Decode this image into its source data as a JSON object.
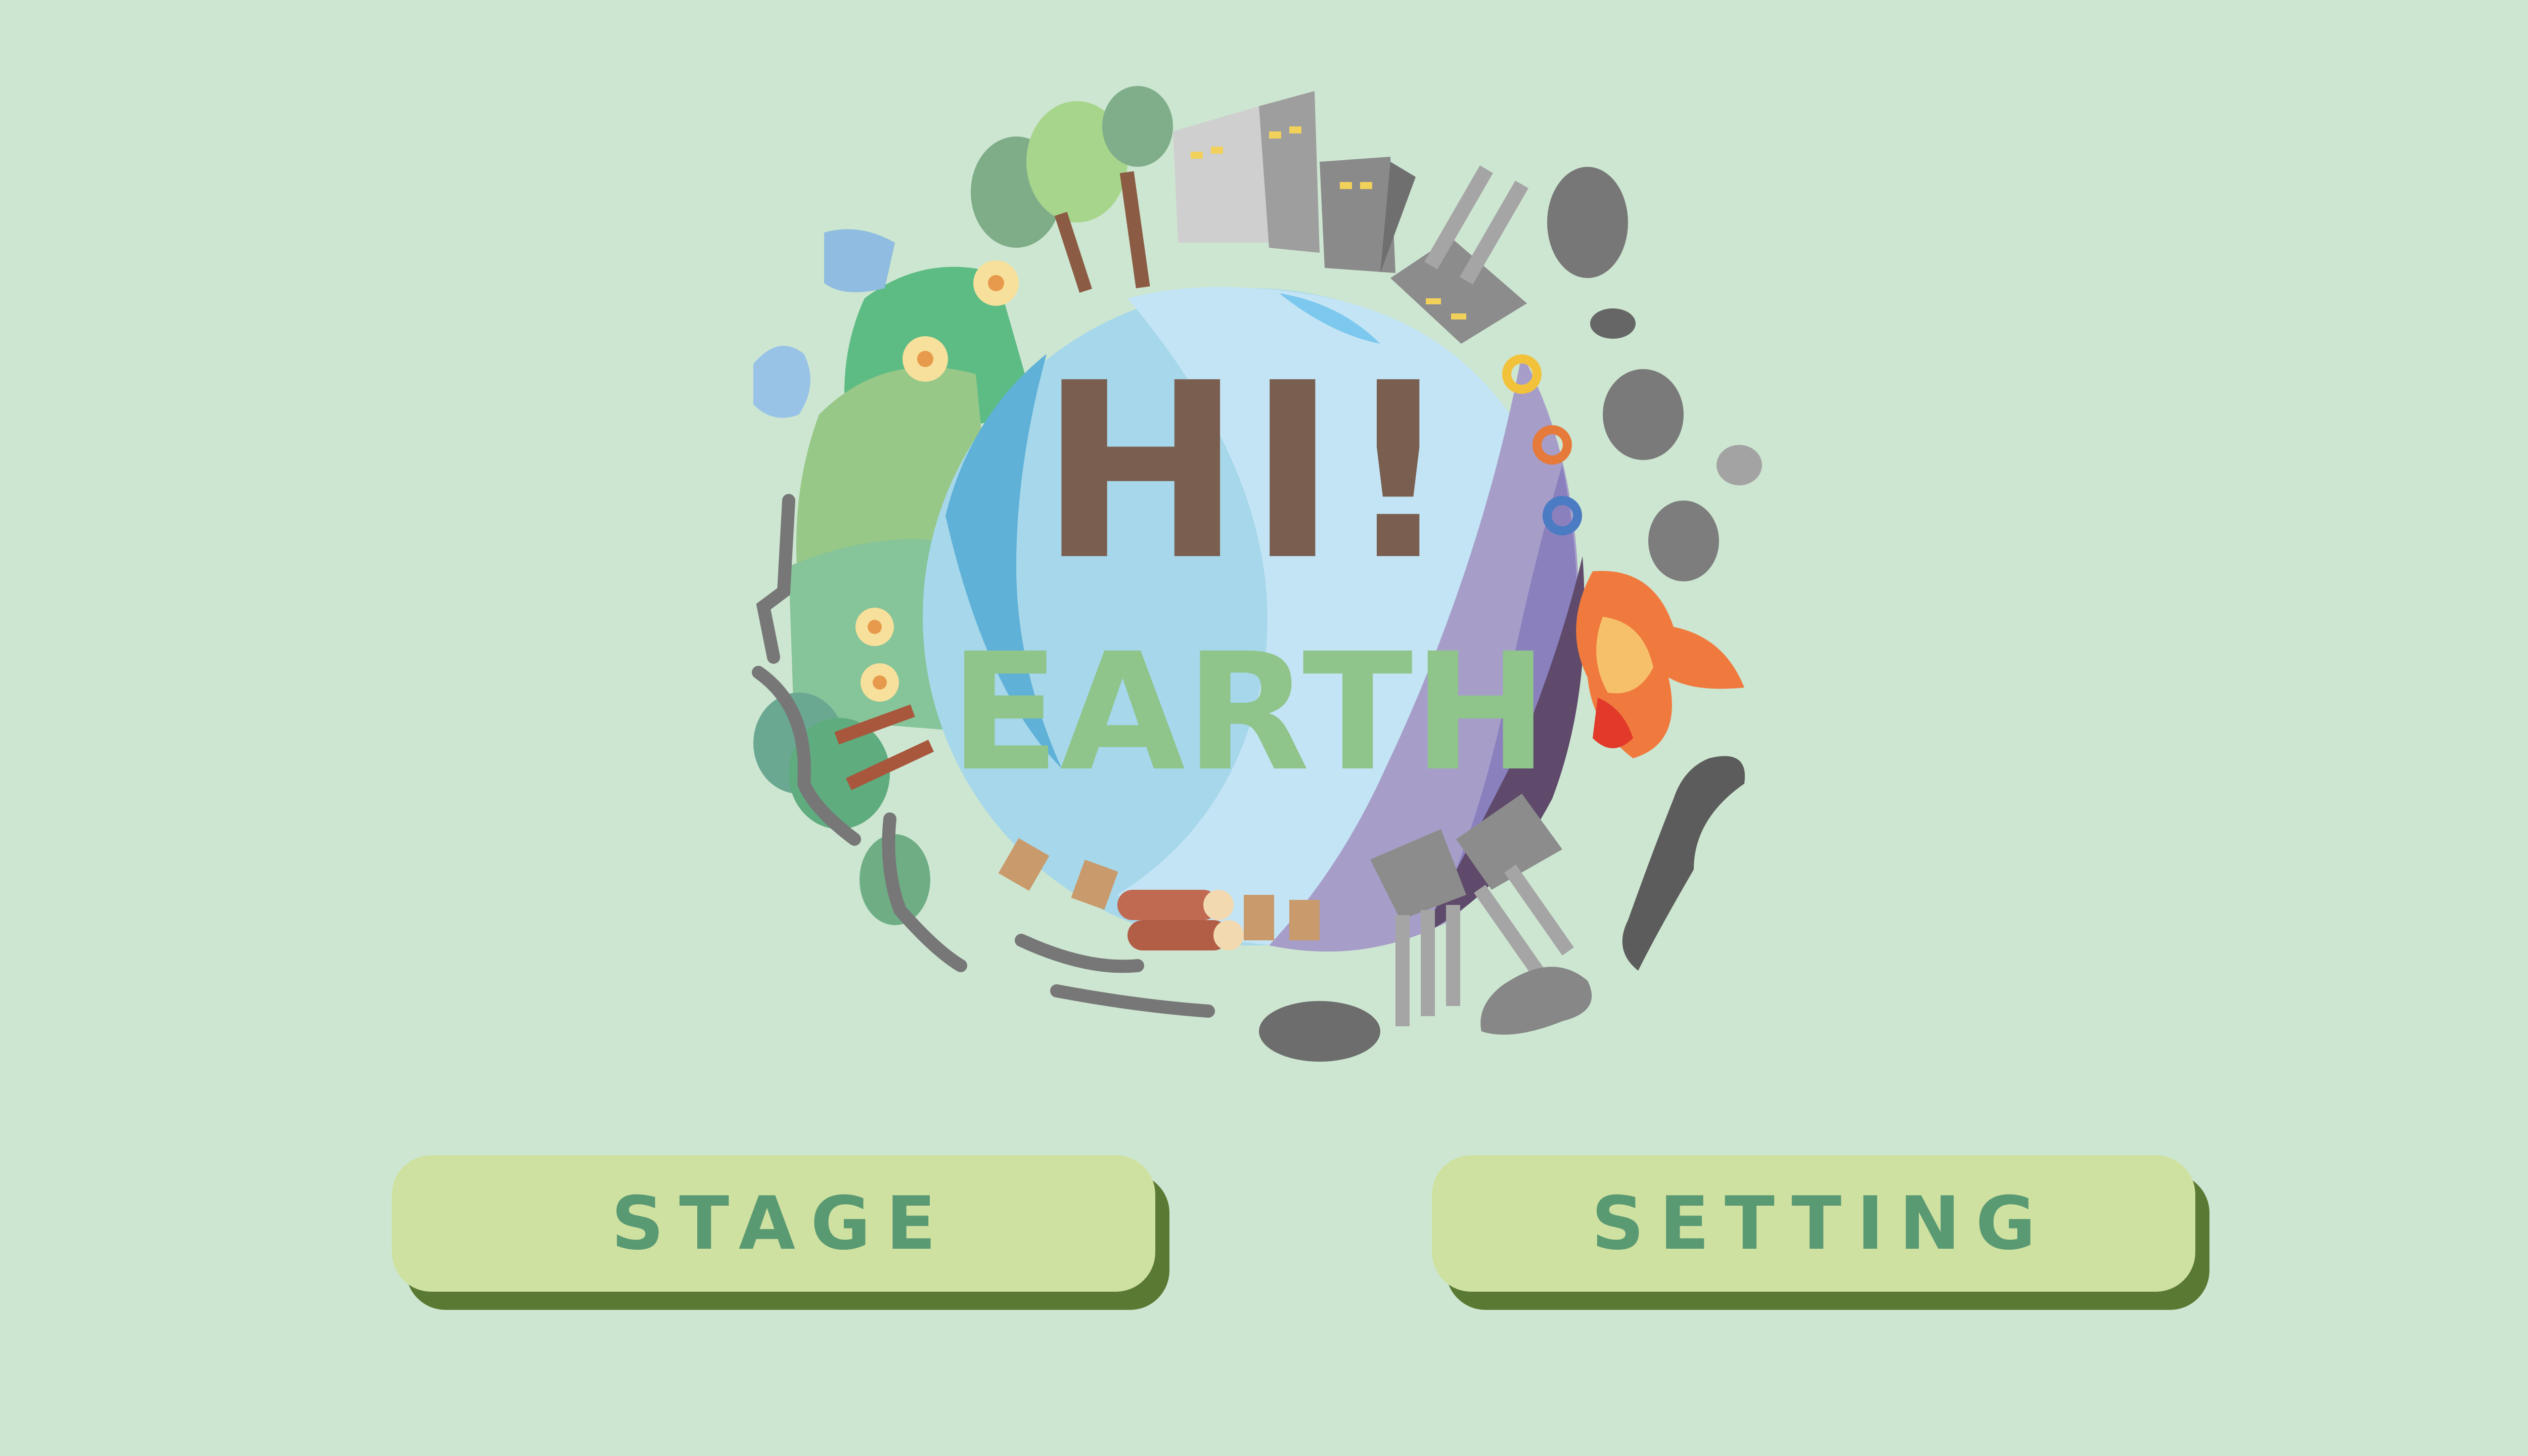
{
  "logo": {
    "title_line1": "HI!",
    "title_line2": "EARTH"
  },
  "menu": {
    "stage_label": "STAGE",
    "setting_label": "SETTING"
  },
  "colors": {
    "background": "#cde6d1",
    "button_fill": "#cfe1a1",
    "button_shadow": "#5a7a33",
    "button_text": "#5a9a73",
    "title_brown": "#7a5f51",
    "title_green": "#8fc48a"
  },
  "icons": [
    "earth-globe-icon",
    "tree-icon",
    "flower-icon",
    "building-icon",
    "factory-icon",
    "smoke-cloud-icon",
    "fire-icon",
    "log-pile-icon",
    "tree-stump-icon"
  ]
}
